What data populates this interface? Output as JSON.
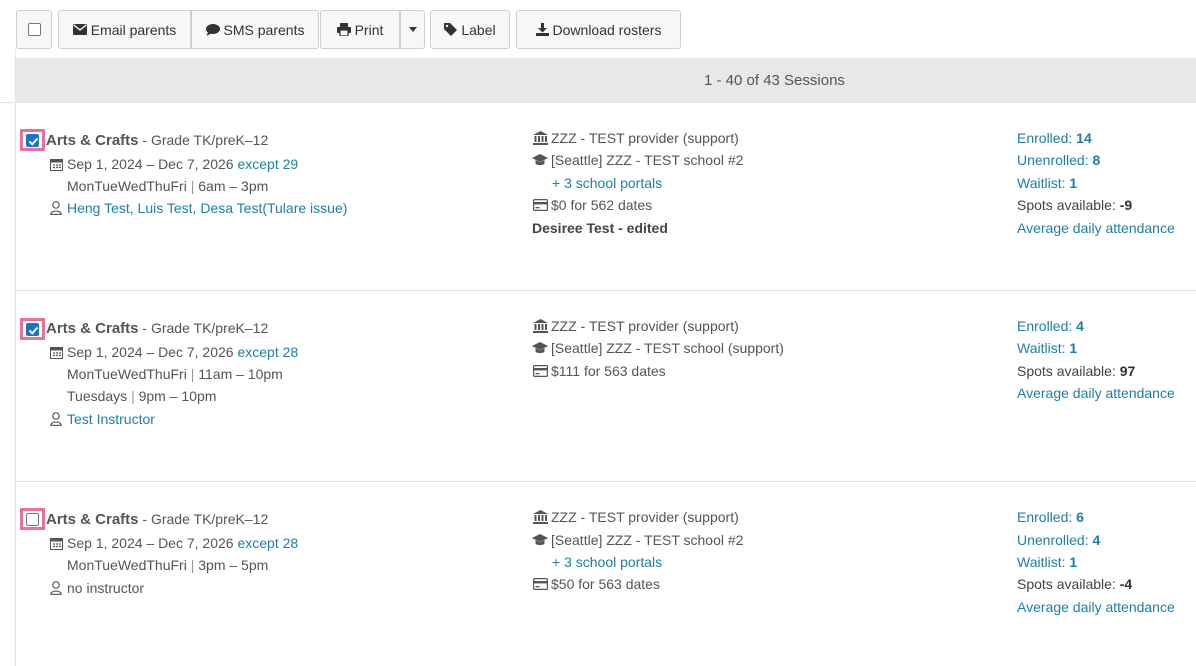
{
  "toolbar": {
    "email_label": "Email parents",
    "sms_label": "SMS parents",
    "print_label": "Print",
    "label_label": "Label",
    "download_label": "Download rosters"
  },
  "pagination": {
    "text": "1 - 40 of 43 Sessions"
  },
  "sessions": [
    {
      "selected": true,
      "name": "Arts & Crafts",
      "grade": " - Grade TK/preK–12",
      "dates": "Sep 1, 2024 – Dec 7, 2026",
      "except": "except 29",
      "schedules": [
        {
          "days": "MonTueWedThuFri",
          "time": "6am – 3pm"
        }
      ],
      "instructors": "Heng Test, Luis Test, Desa Test(Tulare issue)",
      "provider": "ZZZ - TEST provider (support)",
      "school": "[Seattle] ZZZ - TEST school #2",
      "portals": "+ 3 school portals",
      "price": "$0 for 562 dates",
      "note": "Desiree Test - edited",
      "enrolled_label": "Enrolled:",
      "enrolled": "14",
      "unenrolled_label": "Unenrolled:",
      "unenrolled": "8",
      "waitlist_label": "Waitlist:",
      "waitlist": "1",
      "spots_label": "Spots available:",
      "spots": "-9",
      "attendance": "Average daily attendance"
    },
    {
      "selected": true,
      "name": "Arts & Crafts",
      "grade": " - Grade TK/preK–12",
      "dates": "Sep 1, 2024 – Dec 7, 2026",
      "except": "except 28",
      "schedules": [
        {
          "days": "MonTueWedThuFri",
          "time": "11am – 10pm"
        },
        {
          "days": "Tuesdays",
          "time": "9pm – 10pm"
        }
      ],
      "instructors": "Test Instructor",
      "provider": "ZZZ - TEST provider (support)",
      "school": "[Seattle] ZZZ - TEST school (support)",
      "price": "$111 for 563 dates",
      "enrolled_label": "Enrolled:",
      "enrolled": "4",
      "waitlist_label": "Waitlist:",
      "waitlist": "1",
      "spots_label": "Spots available:",
      "spots": "97",
      "attendance": "Average daily attendance"
    },
    {
      "selected": false,
      "name": "Arts & Crafts",
      "grade": " - Grade TK/preK–12",
      "dates": "Sep 1, 2024 – Dec 7, 2026",
      "except": "except 28",
      "schedules": [
        {
          "days": "MonTueWedThuFri",
          "time": "3pm – 5pm"
        }
      ],
      "instructors": "no instructor",
      "provider": "ZZZ - TEST provider (support)",
      "school": "[Seattle] ZZZ - TEST school #2",
      "portals": "+ 3 school portals",
      "price": "$50 for 563 dates",
      "enrolled_label": "Enrolled:",
      "enrolled": "6",
      "unenrolled_label": "Unenrolled:",
      "unenrolled": "4",
      "waitlist_label": "Waitlist:",
      "waitlist": "1",
      "spots_label": "Spots available:",
      "spots": "-4",
      "attendance": "Average daily attendance"
    }
  ],
  "colors": {
    "link": "#1f7fa3",
    "highlight": "#e8709e",
    "checkbox": "#1a73c8"
  },
  "icons": [
    "envelope-icon",
    "comment-icon",
    "print-icon",
    "caret-down-icon",
    "tag-icon",
    "download-icon",
    "calendar-icon",
    "user-icon",
    "bank-icon",
    "graduation-cap-icon",
    "credit-card-icon",
    "check-icon"
  ]
}
